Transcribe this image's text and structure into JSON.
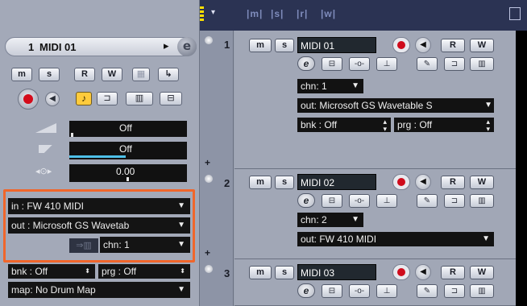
{
  "header": {
    "labels": [
      "m",
      "s",
      "r",
      "w"
    ],
    "dropdown_glyph": "▾",
    "maximize_icon": "window-maximize-icon"
  },
  "inspector": {
    "track_number": "1",
    "track_name": "MIDI 01",
    "buttons": {
      "mute": "m",
      "solo": "s",
      "read": "R",
      "write": "W"
    },
    "volume": "Off",
    "pan": "Off",
    "delay": "0.00",
    "input": "in :  FW 410 MIDI",
    "output": "out :  Microsoft GS Wavetab",
    "channel": "chn:  1",
    "bank": "bnk : Off",
    "program": "prg : Off",
    "map": "map:  No Drum Map",
    "highlight_color": "#f0662b"
  },
  "tracks": [
    {
      "number": "1",
      "name": "MIDI 01",
      "channel": "chn: 1",
      "output": "out: Microsoft GS Wavetable S",
      "bank": "bnk : Off",
      "program": "prg : Off"
    },
    {
      "number": "2",
      "name": "MIDI 02",
      "channel": "chn: 2",
      "output": "out: FW 410 MIDI"
    },
    {
      "number": "3",
      "name": "MIDI 03"
    }
  ],
  "track_buttons": {
    "mute": "m",
    "solo": "s",
    "read": "R",
    "write": "W"
  }
}
